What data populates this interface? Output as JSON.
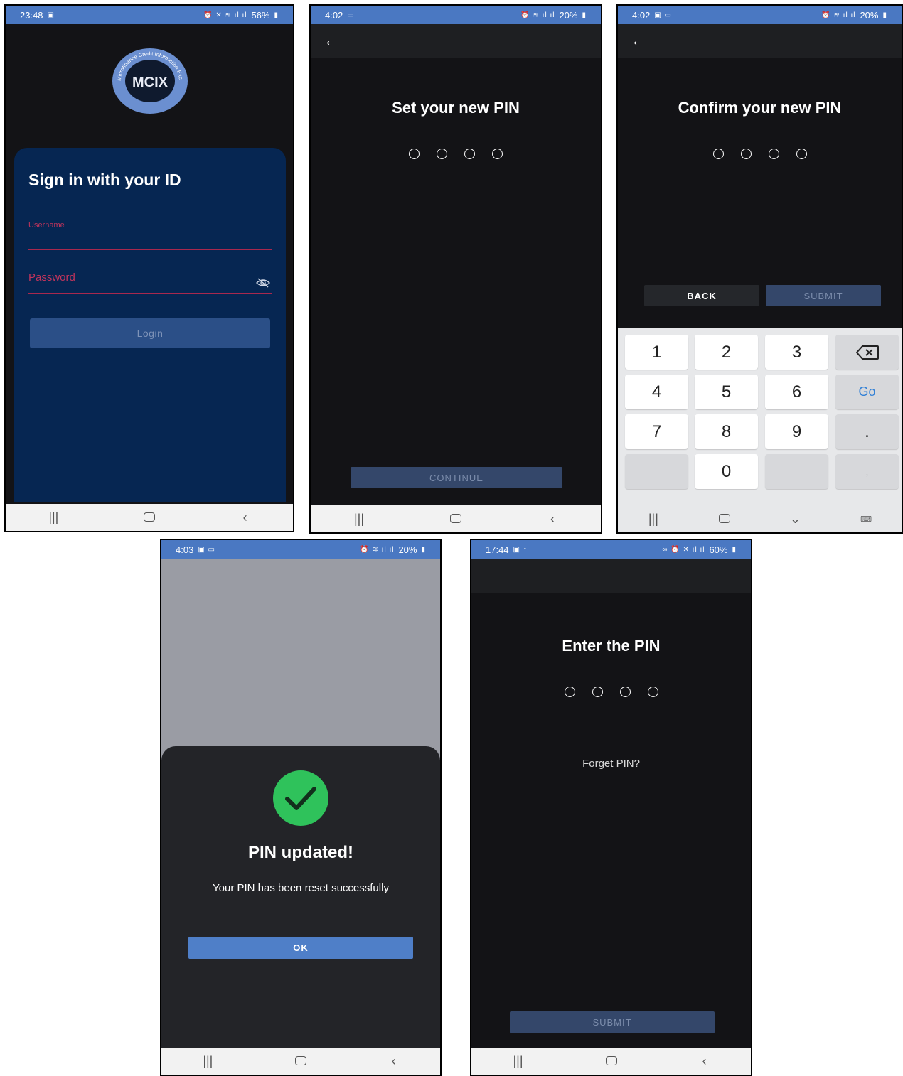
{
  "screen_login": {
    "status": {
      "time": "23:48",
      "battery": "56%"
    },
    "logo": {
      "text": "MCIX",
      "ring_text": "Microfinance Credit Information Exchange"
    },
    "title": "Sign in with your ID",
    "username_label": "Username",
    "password_label": "Password",
    "login_label": "Login"
  },
  "screen_set_pin": {
    "status": {
      "time": "4:02",
      "battery": "20%"
    },
    "title": "Set your new PIN",
    "continue_label": "CONTINUE"
  },
  "screen_confirm_pin": {
    "status": {
      "time": "4:02",
      "battery": "20%"
    },
    "title": "Confirm your new PIN",
    "back_label": "BACK",
    "submit_label": "SUBMIT",
    "keys": [
      "1",
      "2",
      "3",
      "4",
      "5",
      "6",
      "Go",
      "7",
      "8",
      "9",
      ".",
      "0",
      ","
    ]
  },
  "screen_pin_updated": {
    "status": {
      "time": "4:03",
      "battery": "20%"
    },
    "title": "PIN updated!",
    "message": "Your PIN has been reset successfully",
    "ok_label": "OK"
  },
  "screen_enter_pin": {
    "status": {
      "time": "17:44",
      "battery": "60%"
    },
    "title": "Enter the PIN",
    "forget_label": "Forget PIN?",
    "submit_label": "SUBMIT"
  },
  "colors": {
    "status_bar": "#4a78c2",
    "accent_pink": "#c2345c",
    "card_navy": "#062652",
    "success_green": "#2fc25b"
  }
}
